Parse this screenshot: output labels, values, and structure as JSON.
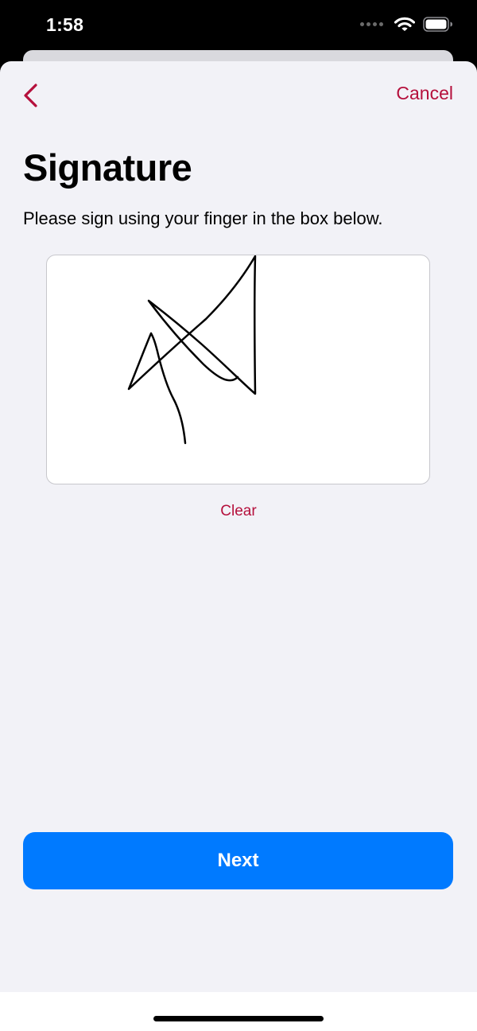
{
  "status_bar": {
    "time": "1:58",
    "icons": [
      "signal-dots-icon",
      "wifi-icon",
      "battery-icon"
    ]
  },
  "nav": {
    "back_icon": "chevron-left-icon",
    "cancel_label": "Cancel"
  },
  "page": {
    "title": "Signature",
    "instructions": "Please sign using your finger in the box below."
  },
  "signature_pad": {
    "has_signature": true,
    "clear_label": "Clear"
  },
  "footer": {
    "next_label": "Next"
  },
  "colors": {
    "accent": "#b5103c",
    "primary_button": "#007aff",
    "background": "#f2f2f7",
    "signature_box_border": "#c7c7cc"
  }
}
